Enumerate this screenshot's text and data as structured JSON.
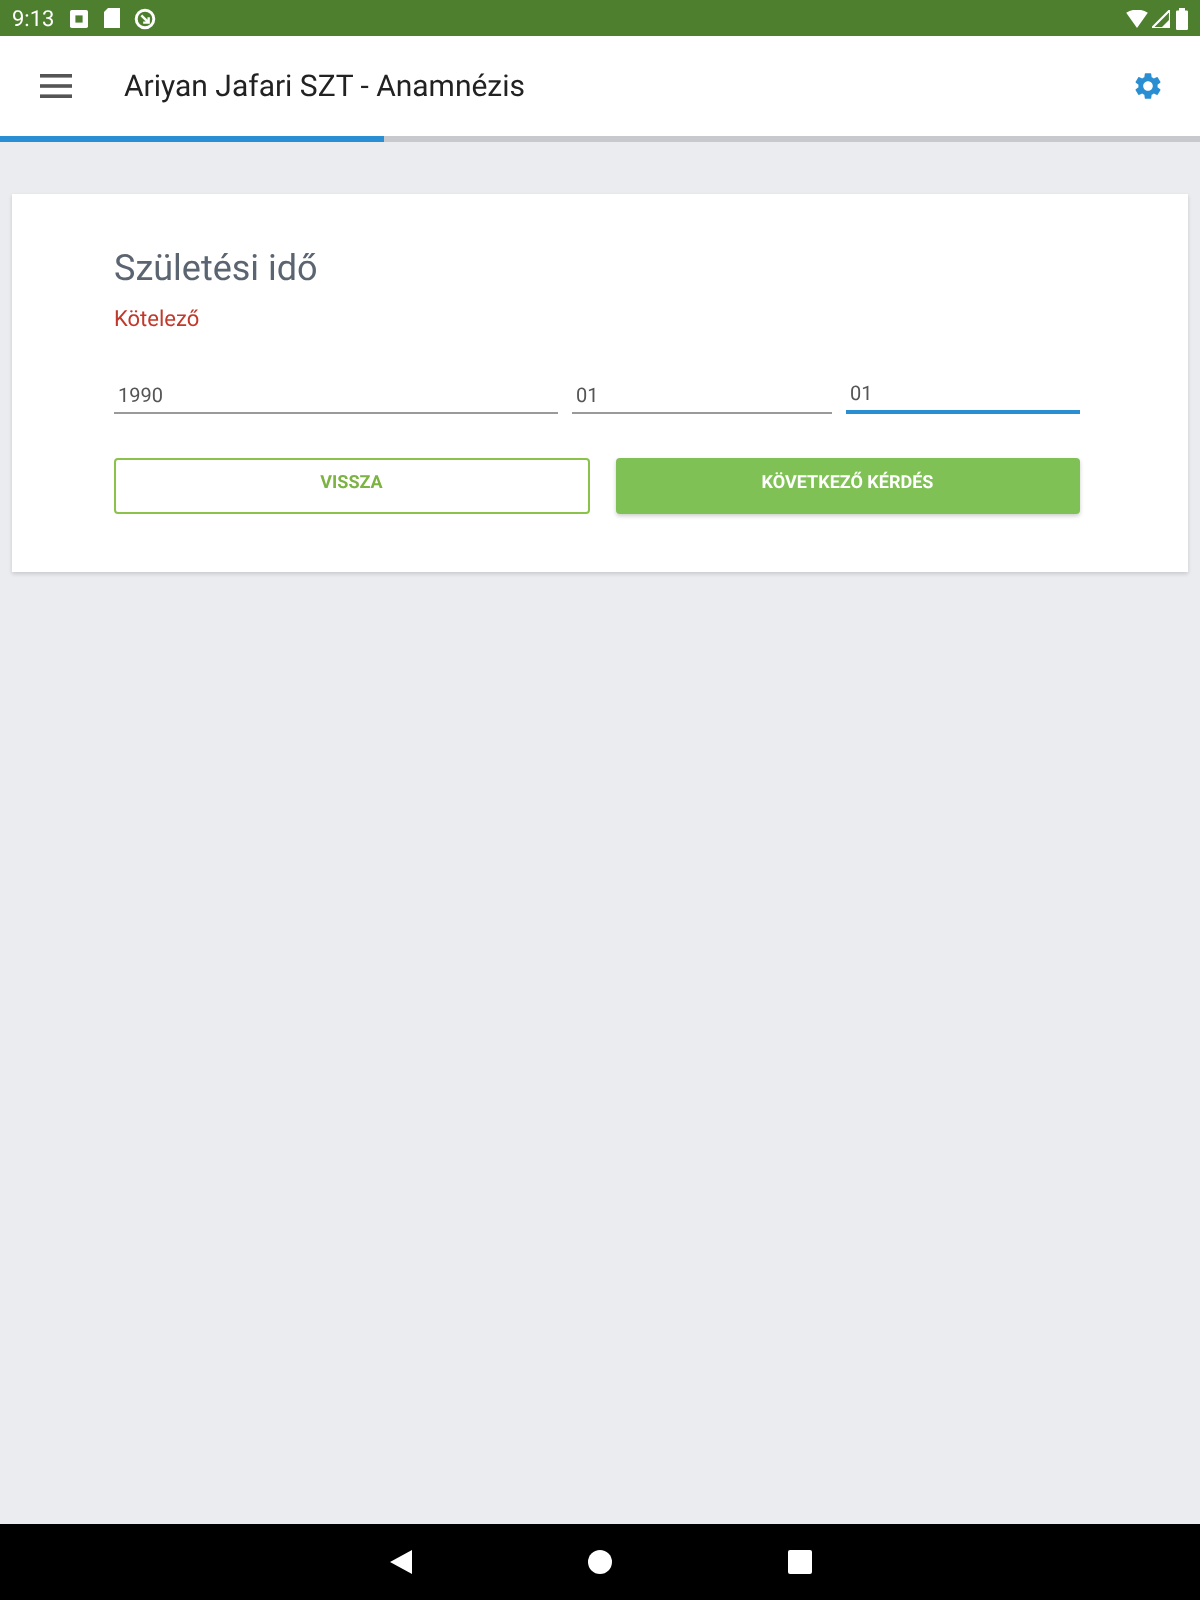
{
  "status_bar": {
    "time": "9:13"
  },
  "app_bar": {
    "title": "Ariyan Jafari SZT - Anamnézis"
  },
  "progress": {
    "level": 0.32
  },
  "question": {
    "title": "Születési idő",
    "required_label": "Kötelező",
    "fields": [
      {
        "value": "1990",
        "focused": false
      },
      {
        "value": "01",
        "focused": false
      },
      {
        "value": "01",
        "focused": true
      }
    ],
    "buttons": [
      {
        "label": "VISSZA",
        "kind": "outlined"
      },
      {
        "label": "KÖVETKEZŐ KÉRDÉS",
        "kind": "filled"
      }
    ]
  }
}
